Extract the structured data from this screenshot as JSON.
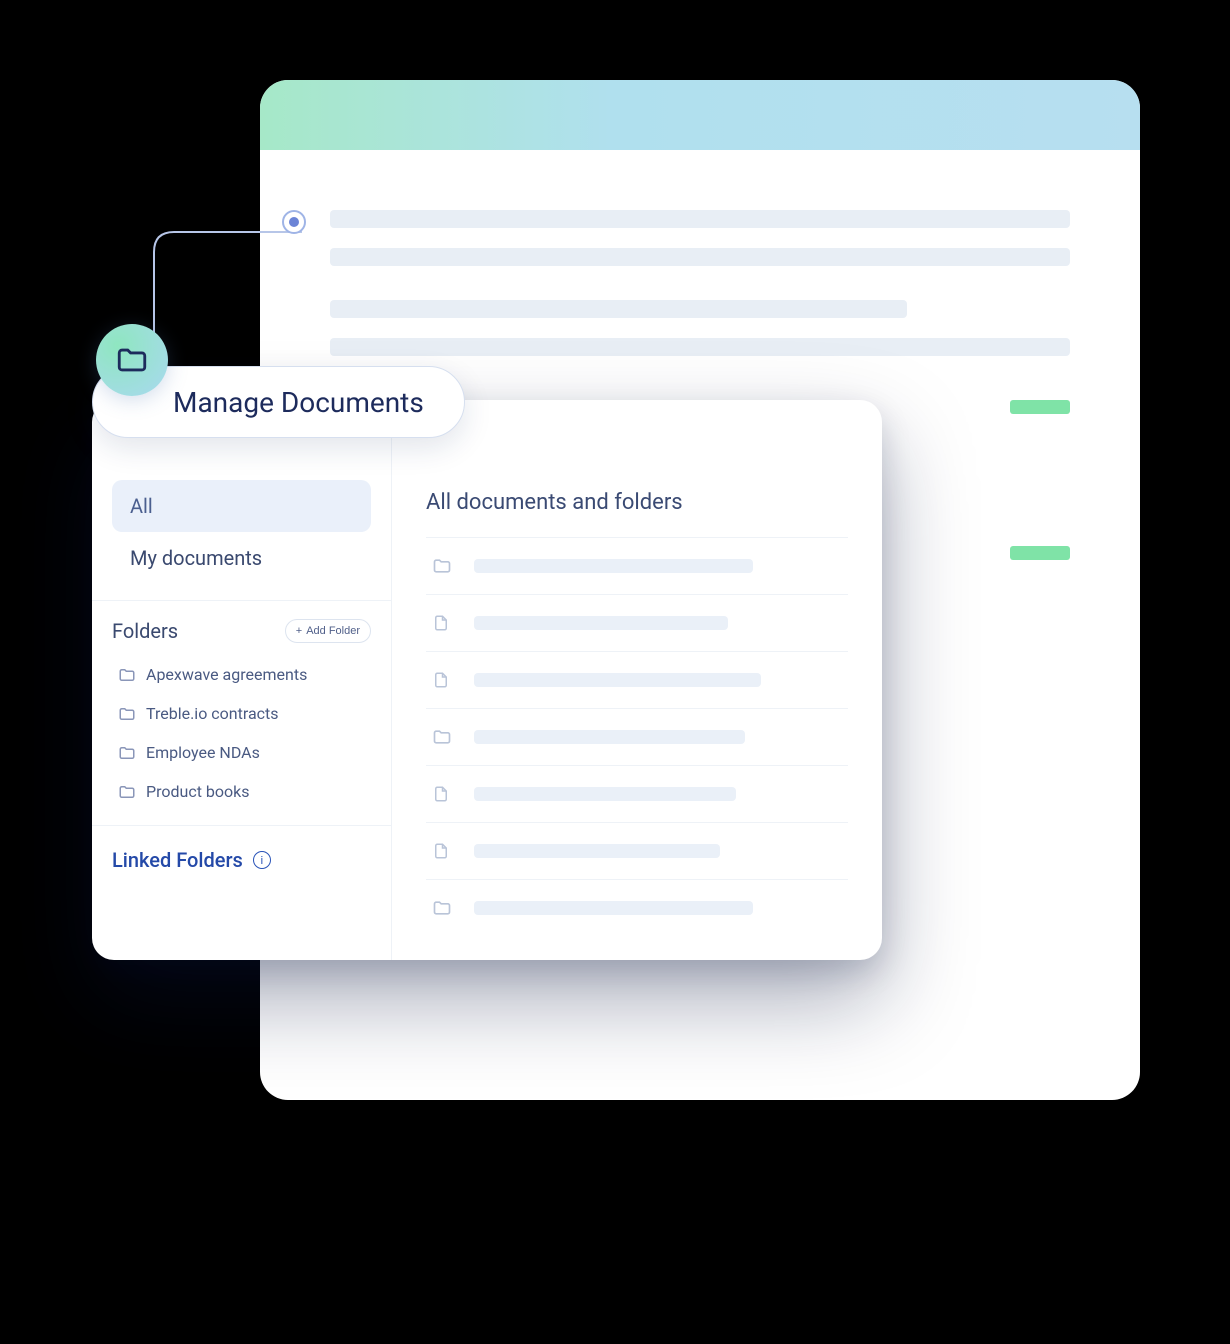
{
  "pill_title": "Manage Documents",
  "sidebar": {
    "nav": [
      {
        "label": "All",
        "active": true
      },
      {
        "label": "My documents",
        "active": false
      }
    ],
    "folders_title": "Folders",
    "add_folder_label": "Add Folder",
    "folders": [
      {
        "label": "Apexwave agreements"
      },
      {
        "label": "Treble.io contracts"
      },
      {
        "label": "Employee NDAs"
      },
      {
        "label": "Product books"
      }
    ],
    "linked_title": "Linked Folders"
  },
  "content": {
    "title": "All documents and folders",
    "rows": [
      {
        "type": "folder"
      },
      {
        "type": "file"
      },
      {
        "type": "file"
      },
      {
        "type": "folder"
      },
      {
        "type": "file"
      },
      {
        "type": "file"
      },
      {
        "type": "folder"
      }
    ]
  }
}
